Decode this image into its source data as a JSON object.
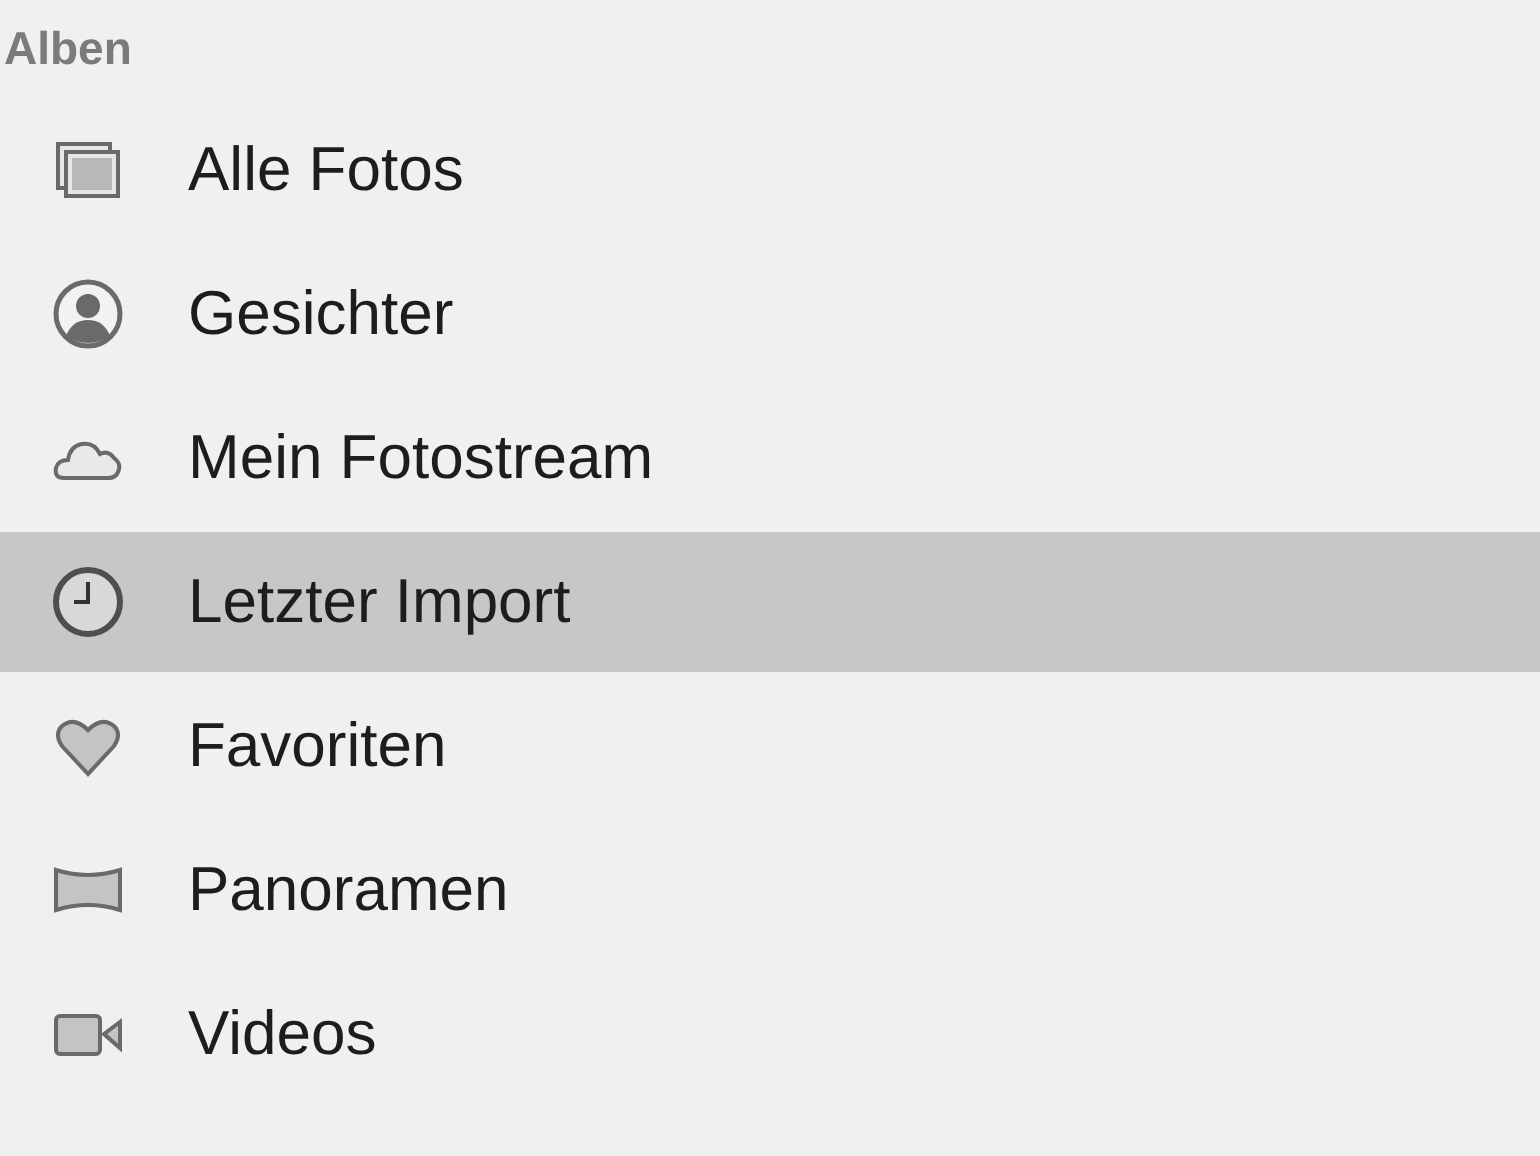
{
  "sidebar": {
    "heading": "Alben",
    "items": [
      {
        "kind": "photos",
        "label": "Alle Fotos",
        "selected": false
      },
      {
        "kind": "faces",
        "label": "Gesichter",
        "selected": false
      },
      {
        "kind": "cloud",
        "label": "Mein Fotostream",
        "selected": false
      },
      {
        "kind": "clock",
        "label": "Letzter Import",
        "selected": true
      },
      {
        "kind": "heart",
        "label": "Favoriten",
        "selected": false
      },
      {
        "kind": "panorama",
        "label": "Panoramen",
        "selected": false
      },
      {
        "kind": "video",
        "label": "Videos",
        "selected": false
      }
    ]
  }
}
